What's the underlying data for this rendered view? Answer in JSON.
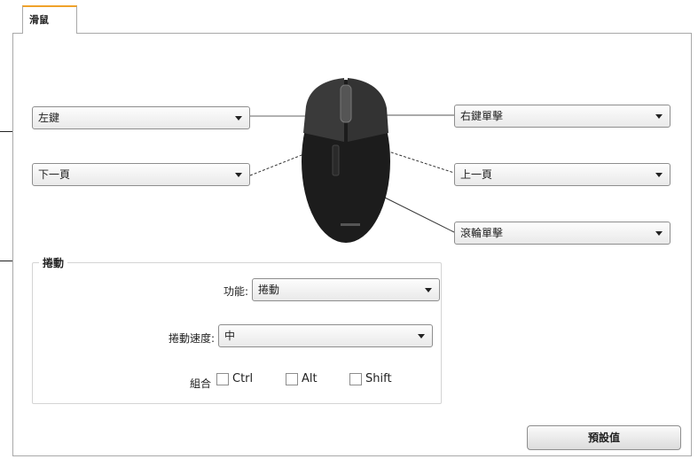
{
  "tab": {
    "label": "滑鼠"
  },
  "buttons": {
    "left": {
      "value": "左鍵"
    },
    "right": {
      "value": "右鍵單擊"
    },
    "back": {
      "value": "下一頁"
    },
    "forward": {
      "value": "上一頁"
    },
    "wheel": {
      "value": "滾輪單擊"
    }
  },
  "scroll_group": {
    "title": "捲動",
    "function_label": "功能:",
    "function_value": "捲動",
    "speed_label": "捲動速度:",
    "speed_value": "中",
    "combo_label": "組合",
    "modifiers": [
      {
        "label": "Ctrl",
        "checked": false
      },
      {
        "label": "Alt",
        "checked": false
      },
      {
        "label": "Shift",
        "checked": false
      }
    ]
  },
  "restore_default_label": "預設值"
}
